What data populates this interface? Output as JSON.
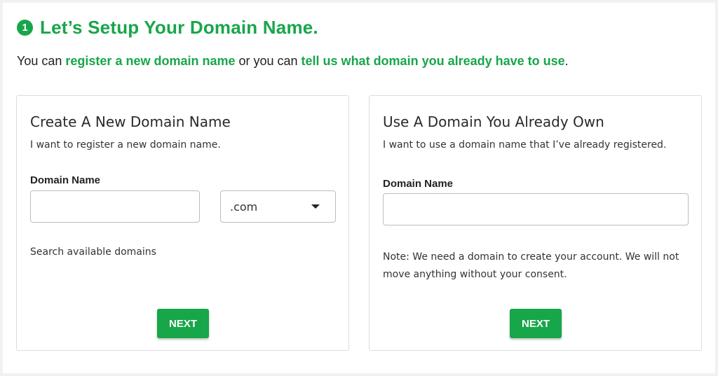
{
  "header": {
    "step_number": "1",
    "title": "Let’s Setup Your Domain Name."
  },
  "intro": {
    "prefix": "You can ",
    "link_register": "register a new domain name",
    "middle": " or you can ",
    "link_existing": "tell us what domain you already have to use",
    "suffix": "."
  },
  "new_domain_card": {
    "title": "Create A New Domain Name",
    "subtitle": "I want to register a new domain name.",
    "field_label": "Domain Name",
    "domain_input_value": "",
    "tld_selected": ".com",
    "search_text": "Search available domains",
    "next_label": "NEXT"
  },
  "existing_domain_card": {
    "title": "Use A Domain You Already Own",
    "subtitle": "I want to use a domain name that I’ve already registered.",
    "field_label": "Domain Name",
    "domain_input_value": "",
    "note": "Note: We need a domain to create your account. We will not move anything without your consent.",
    "next_label": "NEXT"
  },
  "colors": {
    "accent": "#17a64a",
    "border": "#dcdcdc",
    "background": "#f1f1f1"
  }
}
